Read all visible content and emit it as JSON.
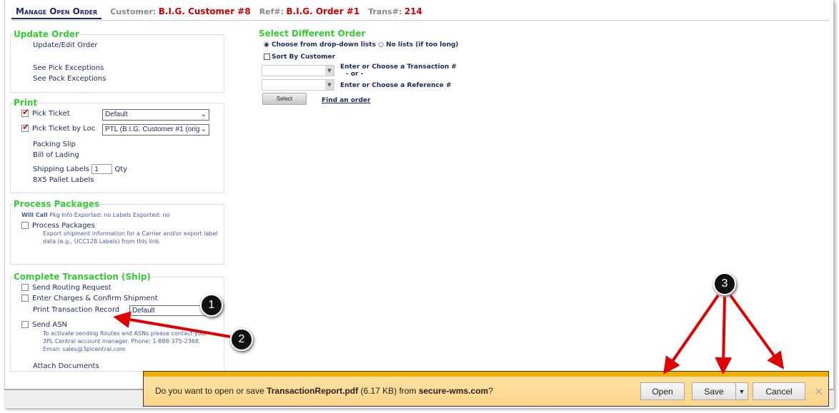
{
  "header": {
    "title": "Manage Open Order",
    "customer_label": "Customer:",
    "customer": "B.I.G. Customer #8",
    "ref_label": "Ref#:",
    "ref": "B.I.G. Order #1",
    "trans_label": "Trans#:",
    "trans": "214"
  },
  "update": {
    "legend": "Update Order",
    "items": [
      "Update/Edit Order",
      "See Pick Exceptions",
      "See Pack Exceptions"
    ]
  },
  "print": {
    "legend": "Print",
    "pick_ticket": "Pick Ticket",
    "pick_ticket_value": "Default",
    "pick_ticket_loc": "Pick Ticket by Loc",
    "pick_ticket_loc_value": "PTL (B.I.G. Customer #1 (orig",
    "packing_slip": "Packing Slip",
    "bol": "Bill of Lading",
    "shipping_labels": "Shipping Labels",
    "qty_value": "1",
    "qty": "Qty",
    "pallet": "8X5 Pallet Labels"
  },
  "packages": {
    "legend": "Process Packages",
    "status_bold": "Will Call",
    "status": "Pkg Info Exported: no Labels Exported: no",
    "process": "Process Packages",
    "note": "Export shipment information for a Carrier and/or export label data (e.g., UCC128 Labels) from this link."
  },
  "complete": {
    "legend": "Complete Transaction (Ship)",
    "routing": "Send Routing Request",
    "charges": "Enter Charges & Confirm Shipment",
    "print_record": "Print Transaction Record",
    "print_record_value": "Default",
    "asn": "Send ASN",
    "asn_note": "To activate sending Routes and ASNs please contact your 3PL Central account manager. Phone: 1-888-375-2368. Email: sales@3plcentral.com",
    "attach": "Attach Documents"
  },
  "select_order": {
    "title": "Select Different Order",
    "radio1": "Choose from drop-down lists",
    "radio2": "No lists (if too long)",
    "sort": "Sort By Customer",
    "trans_label": "Enter or Choose a Transaction #",
    "or": "- or -",
    "ref_label": "Enter or Choose a Reference #",
    "select_btn": "Select",
    "find": "Find an order"
  },
  "download": {
    "prefix": "Do you want to open or save ",
    "file": "TransactionReport.pdf",
    "size": " (6.17 KB) from ",
    "site": "secure-wms.com",
    "suffix": "?",
    "open": "Open",
    "save": "Save",
    "cancel": "Cancel",
    "close": "×"
  },
  "callouts": [
    "1",
    "2",
    "3"
  ],
  "annotation_color": "#e00000"
}
